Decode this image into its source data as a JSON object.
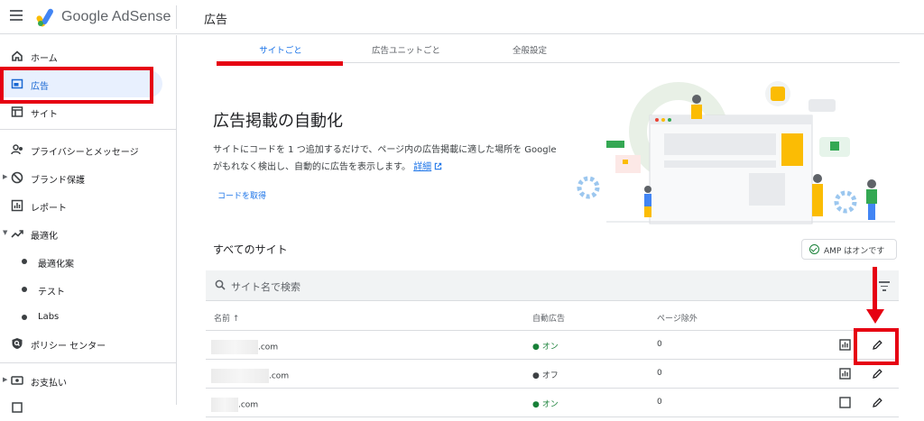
{
  "header": {
    "brand": "Google AdSense",
    "page_title": "広告"
  },
  "sidebar": {
    "items": [
      {
        "label": "ホーム",
        "icon": "home-icon"
      },
      {
        "label": "広告",
        "icon": "ads-icon",
        "active": true
      },
      {
        "label": "サイト",
        "icon": "sites-icon"
      },
      {
        "label": "プライバシーとメッセージ",
        "icon": "privacy-icon"
      },
      {
        "label": "ブランド保護",
        "icon": "block-icon"
      },
      {
        "label": "レポート",
        "icon": "report-icon"
      },
      {
        "label": "最適化",
        "icon": "trending-up-icon"
      },
      {
        "label": "最適化案",
        "sub": true
      },
      {
        "label": "テスト",
        "sub": true
      },
      {
        "label": "Labs",
        "sub": true
      },
      {
        "label": "ポリシー センター",
        "icon": "policy-icon"
      },
      {
        "label": "お支払い",
        "icon": "payments-icon"
      }
    ]
  },
  "tabs": [
    {
      "label": "サイトごと",
      "active": true
    },
    {
      "label": "広告ユニットごと"
    },
    {
      "label": "全般設定"
    }
  ],
  "hero": {
    "title": "広告掲載の自動化",
    "description_1": "サイトにコードを 1 つ追加するだけで、ページ内の広告掲載に適した場所を Google",
    "description_2": "がもれなく検出し、自動的に広告を表示します。",
    "details_link": "詳細",
    "get_code": "コードを取得"
  },
  "sites_section": {
    "title": "すべてのサイト",
    "amp_chip": "AMP はオンです",
    "search_placeholder": "サイト名で検索",
    "columns": {
      "name": "名前 ↑",
      "auto_ads": "自動広告",
      "page_exclusions": "ページ除外"
    },
    "rows": [
      {
        "site_suffix": ".com",
        "auto_ads": "● オン",
        "exclusions": "0"
      },
      {
        "site_suffix": ".com",
        "auto_ads": "● オフ",
        "exclusions": "0"
      },
      {
        "site_suffix": ".com",
        "auto_ads": "● オン",
        "exclusions": "0"
      }
    ]
  },
  "colors": {
    "accent": "#1a73e8",
    "annotation_red": "#e60012",
    "status_green": "#188038",
    "active_bg": "#e8f0fe"
  }
}
